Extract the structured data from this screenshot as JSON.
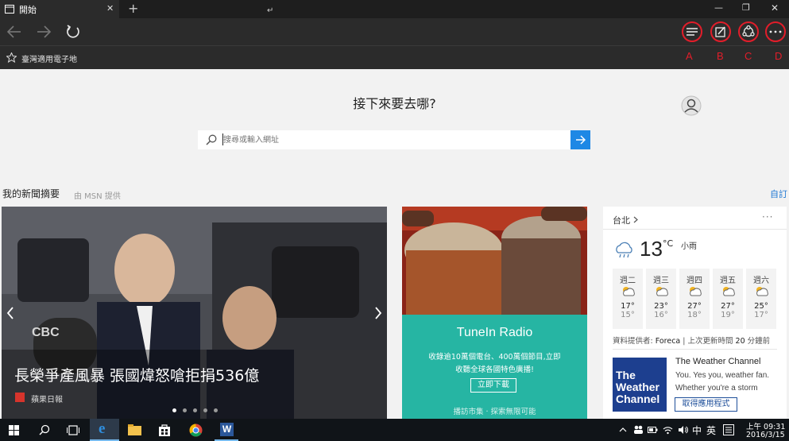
{
  "tab": {
    "title": "開始",
    "close": "✕",
    "new_tab": "+"
  },
  "window": {
    "minimize": "—",
    "maximize": "❐",
    "close": "✕",
    "caret": "↵"
  },
  "favorites": {
    "label": "臺灣適用電子地"
  },
  "annotations": [
    "A",
    "B",
    "C",
    "D"
  ],
  "search": {
    "heading": "接下來要去哪?",
    "placeholder": "搜尋或輸入網址"
  },
  "news": {
    "title": "我的新聞摘要",
    "provider": "由 MSN 提供",
    "customize": "自訂",
    "headline": "長榮爭產風暴 張國煒怒嗆拒捐536億",
    "source": "蘋果日報",
    "badge": "CBC"
  },
  "promo": {
    "title": "TuneIn Radio",
    "line1": "收錄逾10萬個電台、400萬個節目,立即",
    "line2": "收聽全球各國特色廣播!",
    "button": "立即下載",
    "footer": "播訪市集 · 探索無限可能"
  },
  "weather": {
    "city": "台北",
    "more": "···",
    "temp": "13",
    "unit": "°C",
    "condition": "小雨",
    "days": [
      {
        "day": "週二",
        "hi": "17°",
        "lo": "15°"
      },
      {
        "day": "週三",
        "hi": "23°",
        "lo": "16°"
      },
      {
        "day": "週四",
        "hi": "27°",
        "lo": "18°"
      },
      {
        "day": "週五",
        "hi": "27°",
        "lo": "19°"
      },
      {
        "day": "週六",
        "hi": "25°",
        "lo": "17°"
      }
    ],
    "credit_prefix": "資料提供者: ",
    "credit_provider": "Foreca",
    "credit_suffix": " | 上次更新時間 ",
    "credit_minutes": "20",
    "credit_end": " 分鐘前"
  },
  "ad": {
    "title": "The Weather Channel",
    "line1": "You. Yes you, weather fan.",
    "line2": "Whether you're a storm",
    "button": "取得應用程式",
    "logo": "The Weather Channel"
  },
  "taskbar": {
    "ime1": "中",
    "ime2": "英",
    "time": "上午 09:31",
    "date": "2016/3/15"
  }
}
